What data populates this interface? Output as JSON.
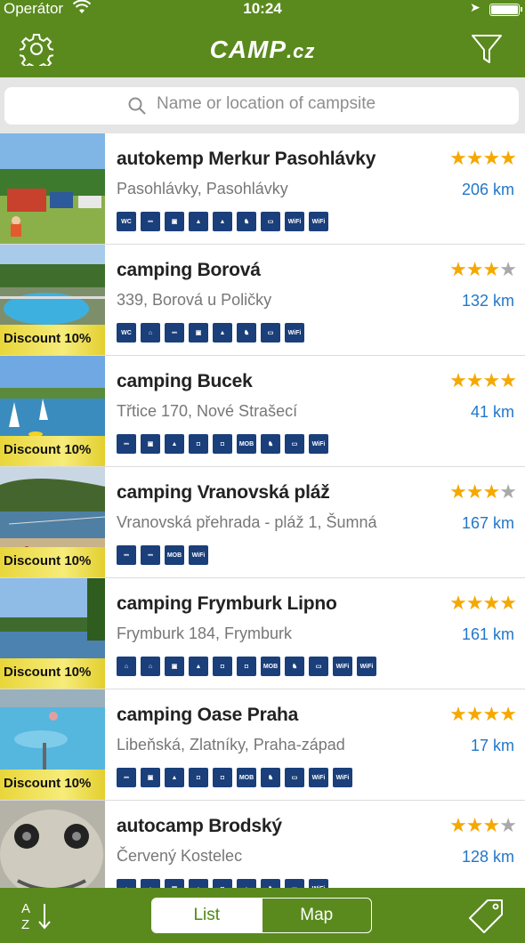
{
  "status_bar": {
    "carrier": "Operátor",
    "time": "10:24"
  },
  "header": {
    "logo_main": "CAMP",
    "logo_suffix": ".cz"
  },
  "search": {
    "placeholder": "Name or location of campsite"
  },
  "colors": {
    "header_green": "#5a8a1e",
    "distance_blue": "#2277c9",
    "star_gold": "#f5a800",
    "amenity_navy": "#1a3f7a"
  },
  "camps": [
    {
      "name": "autokemp Merkur Pasohlávky",
      "address": "Pasohlávky, Pasohlávky",
      "distance": "206 km",
      "stars": 4,
      "discount": "",
      "amenities": [
        "WC",
        "SHW",
        "CAR",
        "TNT",
        "TNT",
        "DOG",
        "TV",
        "WIFI",
        "WIFI"
      ]
    },
    {
      "name": "camping Borová",
      "address": " 339, Borová u Poličky",
      "distance": "132 km",
      "stars": 3,
      "discount": "Discount 10%",
      "amenities": [
        "WC",
        "HUT",
        "SHW",
        "CAR",
        "TNT",
        "DOG",
        "TV",
        "WIFI"
      ]
    },
    {
      "name": "camping Bucek",
      "address": "Třtice 170, Nové Strašecí",
      "distance": "41 km",
      "stars": 4,
      "discount": "Discount 10%",
      "amenities": [
        "SHW",
        "CAR",
        "TNT",
        "CRV",
        "CRV",
        "MOB",
        "DOG",
        "TV",
        "WIFI"
      ]
    },
    {
      "name": "camping Vranovská pláž",
      "address": "Vranovská přehrada - pláž 1, Šumná",
      "distance": "167 km",
      "stars": 3,
      "discount": "Discount 10%",
      "amenities": [
        "SHW",
        "SHW",
        "MOB",
        "WIFI"
      ]
    },
    {
      "name": "camping Frymburk Lipno",
      "address": "Frymburk 184, Frymburk",
      "distance": "161 km",
      "stars": 4,
      "discount": "Discount 10%",
      "amenities": [
        "HUT",
        "HUT",
        "CAR",
        "TNT",
        "CRV",
        "CRV",
        "MOB",
        "DOG",
        "TV",
        "WIFI",
        "WIFI"
      ]
    },
    {
      "name": "camping Oase Praha",
      "address": "Libeňská, Zlatníky, Praha-západ",
      "distance": "17 km",
      "stars": 4,
      "discount": "Discount 10%",
      "amenities": [
        "SHW",
        "CAR",
        "TNT",
        "CRV",
        "CRV",
        "MOB",
        "DOG",
        "TV",
        "WIFI",
        "WIFI"
      ]
    },
    {
      "name": "autocamp Brodský",
      "address": "Červený Kostelec",
      "distance": "128 km",
      "stars": 3,
      "discount": "",
      "amenities": [
        "HUT",
        "HUT",
        "CAR",
        "TNT",
        "CRV",
        "TNT",
        "DOG",
        "TV",
        "WIFI"
      ]
    }
  ],
  "bottom_bar": {
    "sort_label": "A Z",
    "tab_list": "List",
    "tab_map": "Map",
    "active_tab": "List"
  }
}
